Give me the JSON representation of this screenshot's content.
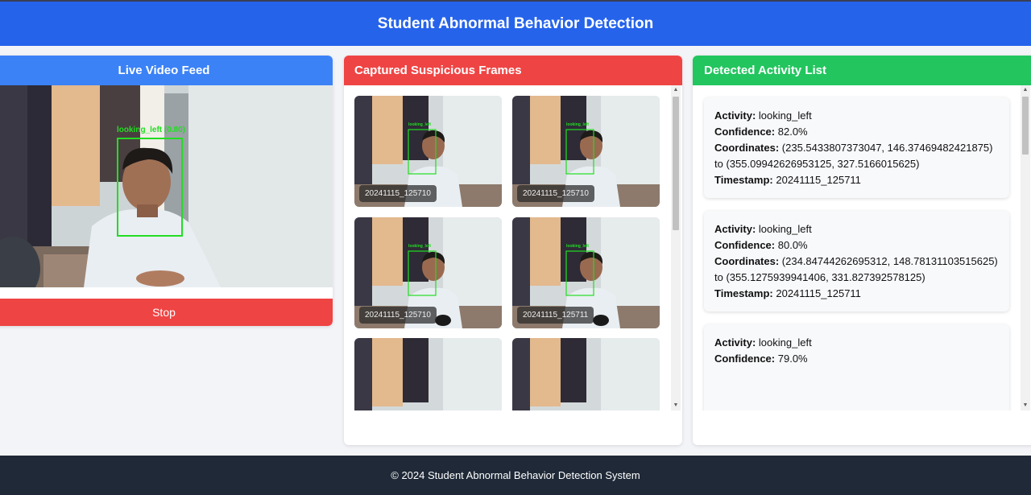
{
  "header": {
    "title": "Student Abnormal Behavior Detection"
  },
  "live": {
    "title": "Live Video Feed",
    "detection_label": "looking_left (0.80)",
    "stop_label": "Stop"
  },
  "frames": {
    "title": "Captured Suspicious Frames",
    "items": [
      {
        "timestamp": "20241115_125710",
        "label": "looking_left"
      },
      {
        "timestamp": "20241115_125710",
        "label": "looking_left"
      },
      {
        "timestamp": "20241115_125710",
        "label": "looking_left"
      },
      {
        "timestamp": "20241115_125711",
        "label": "looking_left"
      },
      {
        "timestamp": "",
        "label": ""
      },
      {
        "timestamp": "",
        "label": ""
      }
    ]
  },
  "activities": {
    "title": "Detected Activity List",
    "labels": {
      "activity": "Activity:",
      "confidence": "Confidence:",
      "coordinates": "Coordinates:",
      "timestamp": "Timestamp:",
      "to": "to"
    },
    "items": [
      {
        "activity": "looking_left",
        "confidence": "82.0%",
        "coord_from": "(235.5433807373047, 146.37469482421875)",
        "coord_to": "(355.09942626953125, 327.5166015625)",
        "timestamp": "20241115_125711"
      },
      {
        "activity": "looking_left",
        "confidence": "80.0%",
        "coord_from": "(234.84744262695312, 148.78131103515625)",
        "coord_to": "(355.1275939941406, 331.827392578125)",
        "timestamp": "20241115_125711"
      },
      {
        "activity": "looking_left",
        "confidence": "79.0%",
        "coord_from": "",
        "coord_to": "",
        "timestamp": ""
      }
    ]
  },
  "footer": {
    "text": "© 2024 Student Abnormal Behavior Detection System"
  },
  "colors": {
    "header": "#2563eb",
    "live": "#3b82f6",
    "frames": "#ef4444",
    "activities": "#22c55e",
    "footer": "#1f2937",
    "detection_box": "#22dd22"
  }
}
